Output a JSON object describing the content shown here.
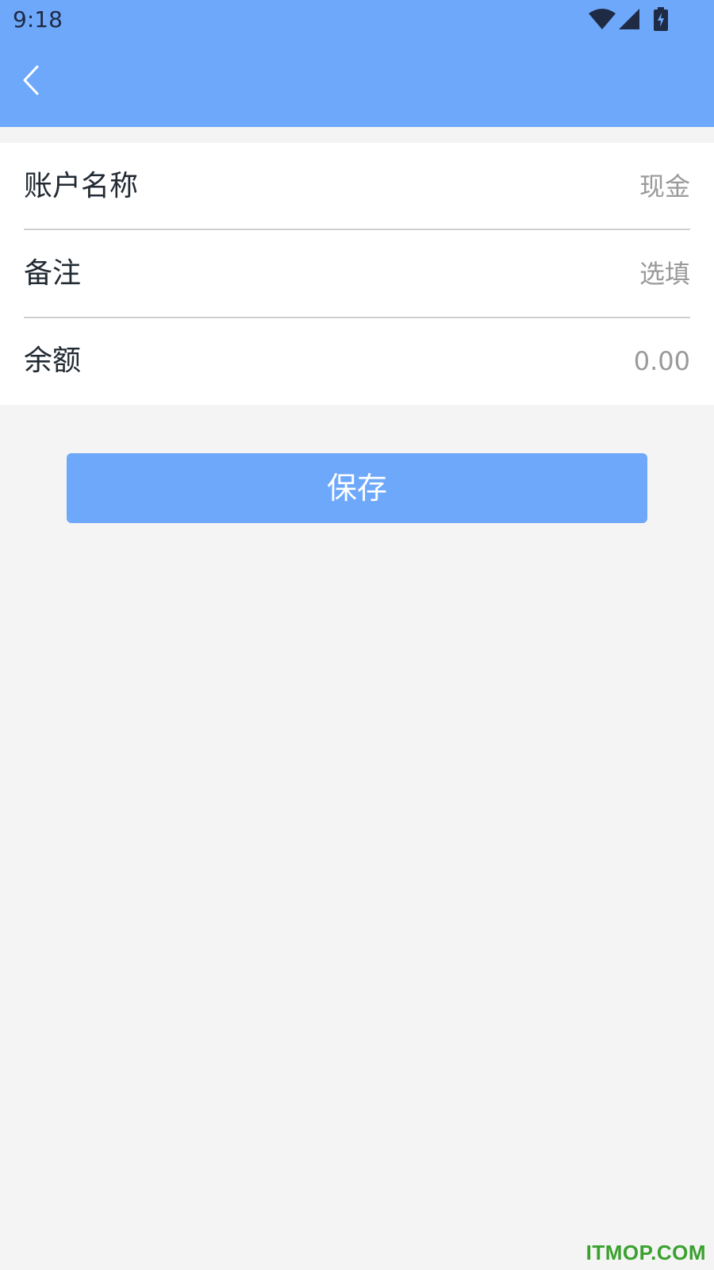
{
  "status_bar": {
    "time": "9:18",
    "icons": [
      "wifi-icon",
      "cell-signal-icon",
      "battery-charging-icon"
    ]
  },
  "header": {
    "back_icon": "chevron-left-icon",
    "background_color": "#6ea8fb"
  },
  "form": {
    "rows": [
      {
        "label": "账户名称",
        "value": "",
        "placeholder": "现金"
      },
      {
        "label": "备注",
        "value": "",
        "placeholder": "选填"
      },
      {
        "label": "余额",
        "value": "",
        "placeholder": "0.00"
      }
    ]
  },
  "save_button": {
    "label": "保存",
    "color": "#6ea8fb"
  },
  "watermark": "ITMOP.COM"
}
